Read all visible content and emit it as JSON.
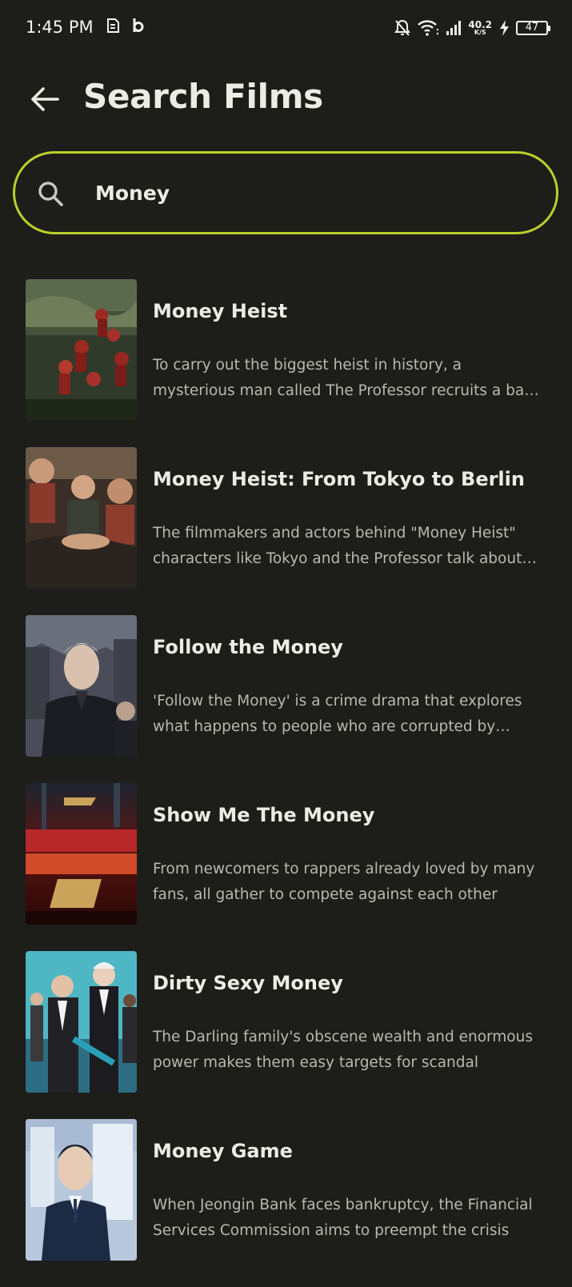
{
  "status_bar": {
    "time": "1:45 PM",
    "net_speed_value": "40.2",
    "net_speed_unit": "K/S",
    "battery": "47",
    "icons": [
      "sim-icon",
      "b-icon",
      "mute-bell-icon",
      "wifi-icon",
      "signal-icon",
      "charging-icon",
      "battery-icon"
    ]
  },
  "header": {
    "title": "Search Films",
    "back_icon": "arrow-left-icon"
  },
  "search": {
    "value": "Money",
    "icon": "search-icon",
    "accent_color": "#b9cf2b"
  },
  "results": [
    {
      "title": "Money Heist",
      "description": "To carry out the biggest heist in history, a mysterious man called The Professor recruits a band of eight robbers"
    },
    {
      "title": "Money Heist: From Tokyo to Berlin",
      "description": "The filmmakers and actors behind \"Money Heist\" characters like Tokyo and the Professor talk about the series"
    },
    {
      "title": "Follow the Money",
      "description": "'Follow the Money' is a crime drama that explores what happens to people who are corrupted by money"
    },
    {
      "title": "Show Me The Money",
      "description": "From newcomers to rappers already loved by many fans, all gather to compete against each other"
    },
    {
      "title": "Dirty Sexy Money",
      "description": "The Darling family's obscene wealth and enormous power makes them easy  targets for scandal"
    },
    {
      "title": "Money Game",
      "description": "When Jeongin Bank faces bankruptcy, the Financial Services Commission aims to preempt the crisis"
    }
  ]
}
